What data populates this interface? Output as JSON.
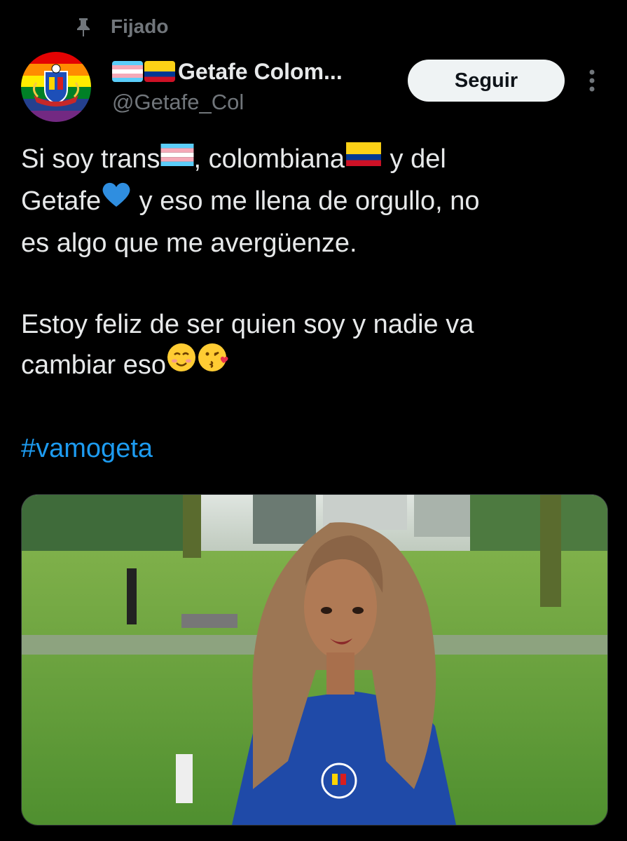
{
  "pinned": {
    "label": "Fijado",
    "icon": "pin-icon"
  },
  "author": {
    "display_name": "Getafe Colom...",
    "handle": "@Getafe_Col",
    "avatar_icon": "getafe-colombia-pride-logo",
    "flags": [
      "trans-flag-icon",
      "colombia-flag-icon"
    ]
  },
  "actions": {
    "follow_label": "Seguir",
    "more_icon": "more-vertical-icon"
  },
  "tweet": {
    "line1a": "Si soy trans",
    "line1b": ", colombiana",
    "line1c": " y del",
    "line2a": "Getafe",
    "line2b": " y eso me llena de orgullo, no",
    "line3": "es algo que me avergüenze.",
    "line4": "Estoy feliz de ser quien soy y nadie va",
    "line5": "cambiar eso",
    "hashtag": "#vamogeta"
  },
  "media": {
    "description_icon": "photo-person-in-park"
  },
  "colors": {
    "background": "#000000",
    "text": "#e7e9ea",
    "secondary": "#71767b",
    "link": "#1d9bf0",
    "button_bg": "#eff3f4"
  }
}
